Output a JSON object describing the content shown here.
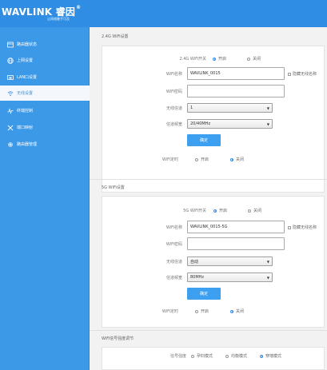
{
  "header": {
    "logo_text": "WAVLINK 睿因",
    "logo_reg": "®",
    "slogan": "让网络触手可及"
  },
  "sidebar": {
    "items": [
      {
        "label": "路由器状态",
        "icon": "router-status-icon"
      },
      {
        "label": "上网设置",
        "icon": "globe-icon"
      },
      {
        "label": "LAN口设置",
        "icon": "lan-port-icon"
      },
      {
        "label": "无线设置",
        "icon": "wifi-icon",
        "active": true
      },
      {
        "label": "终端控制",
        "icon": "activity-icon"
      },
      {
        "label": "端口映射",
        "icon": "tools-icon"
      },
      {
        "label": "路由器管理",
        "icon": "gear-icon"
      }
    ]
  },
  "wifi24": {
    "section_title": "2.4G WiFi设置",
    "switch_label": "2.4G WiFi开关",
    "on_label": "开启",
    "off_label": "关闭",
    "switch_value": "on",
    "ssid_label": "WiFi名称",
    "ssid_value": "WAVLINK_0015",
    "hide_label": "隐藏无线名称",
    "password_label": "WiFi密码",
    "password_value": "",
    "channel_label": "无线信道",
    "channel_value": "1",
    "bandwidth_label": "信道频宽",
    "bandwidth_value": "20/40MHz",
    "confirm_label": "确定",
    "timer_label": "WiFi定时",
    "timer_on_label": "开启",
    "timer_off_label": "关闭",
    "timer_value": "off"
  },
  "wifi5": {
    "section_title": "5G WiFi设置",
    "switch_label": "5G WiFi开关",
    "on_label": "开启",
    "off_label": "关闭",
    "switch_value": "on",
    "ssid_label": "WiFi名称",
    "ssid_value": "WAVLINK_0015-5G",
    "hide_label": "隐藏无线名称",
    "password_label": "WiFi密码",
    "password_value": "",
    "channel_label": "无线信道",
    "channel_value": "自动",
    "bandwidth_label": "信道频宽",
    "bandwidth_value": "80MHz",
    "confirm_label": "确定",
    "timer_label": "WiFi定时",
    "timer_on_label": "开启",
    "timer_off_label": "关闭",
    "timer_value": "off"
  },
  "signal": {
    "section_title": "WiFi信号强度调节",
    "label": "信号强度",
    "options": [
      "孕妇模式",
      "均衡模式",
      "穿墙模式"
    ],
    "selected": "穿墙模式"
  },
  "colors": {
    "header_blue": "#2f8ee3",
    "sidebar_blue": "#3b99e8",
    "button_blue": "#3d9ff0"
  }
}
